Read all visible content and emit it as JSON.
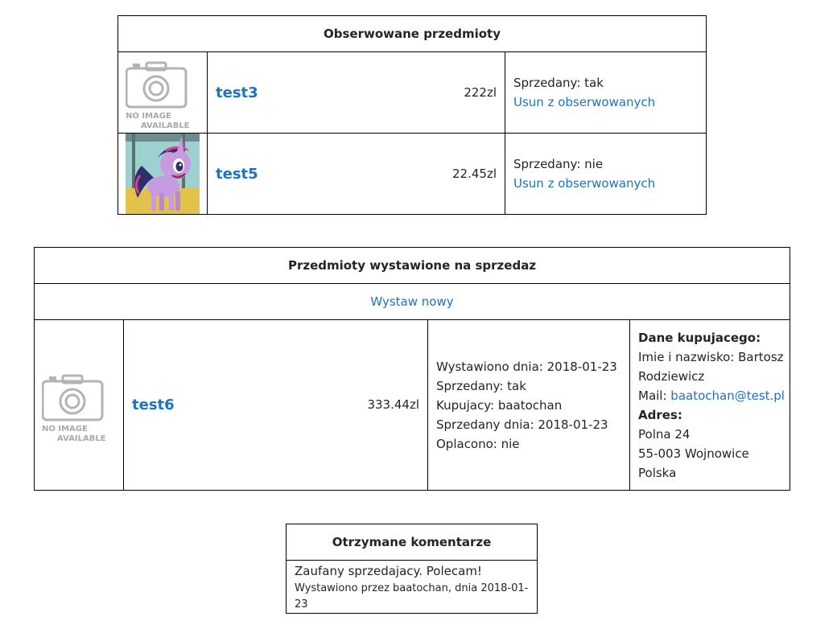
{
  "watched": {
    "title": "Obserwowane przedmioty",
    "items": [
      {
        "name": "test3",
        "price": "222zl",
        "sold": "Sprzedany: tak",
        "action": "Usun z obserwowanych",
        "image": "no-image"
      },
      {
        "name": "test5",
        "price": "22.45zl",
        "sold": "Sprzedany: nie",
        "action": "Usun z obserwowanych",
        "image": "pony-image"
      }
    ]
  },
  "for_sale": {
    "title": "Przedmioty wystawione na sprzedaz",
    "new_link": "Wystaw nowy",
    "items": [
      {
        "name": "test6",
        "price": "333.44zl",
        "listed": "Wystawiono dnia: 2018-01-23",
        "sold": "Sprzedany: tak",
        "buyer": "Kupujacy: baatochan",
        "sold_date": "Sprzedany dnia: 2018-01-23",
        "paid": "Oplacono: nie",
        "buyer_header": "Dane kupujacego:",
        "fullname_label": "Imie i nazwisko: Bartosz",
        "fullname_rest": "Rodziewicz",
        "mail_label": "Mail: ",
        "mail": "baatochan@test.pl",
        "address_header": "Adres:",
        "street": "Polna 24",
        "city": "55-003 Wojnowice",
        "country": "Polska"
      }
    ]
  },
  "no_image_text": {
    "line1": "NO IMAGE",
    "line2": "AVAILABLE"
  },
  "comments": {
    "title": "Otrzymane komentarze",
    "items": [
      {
        "text": "Zaufany sprzedajacy. Polecam!",
        "meta": "Wystawiono przez baatochan, dnia 2018-01-23"
      }
    ]
  }
}
